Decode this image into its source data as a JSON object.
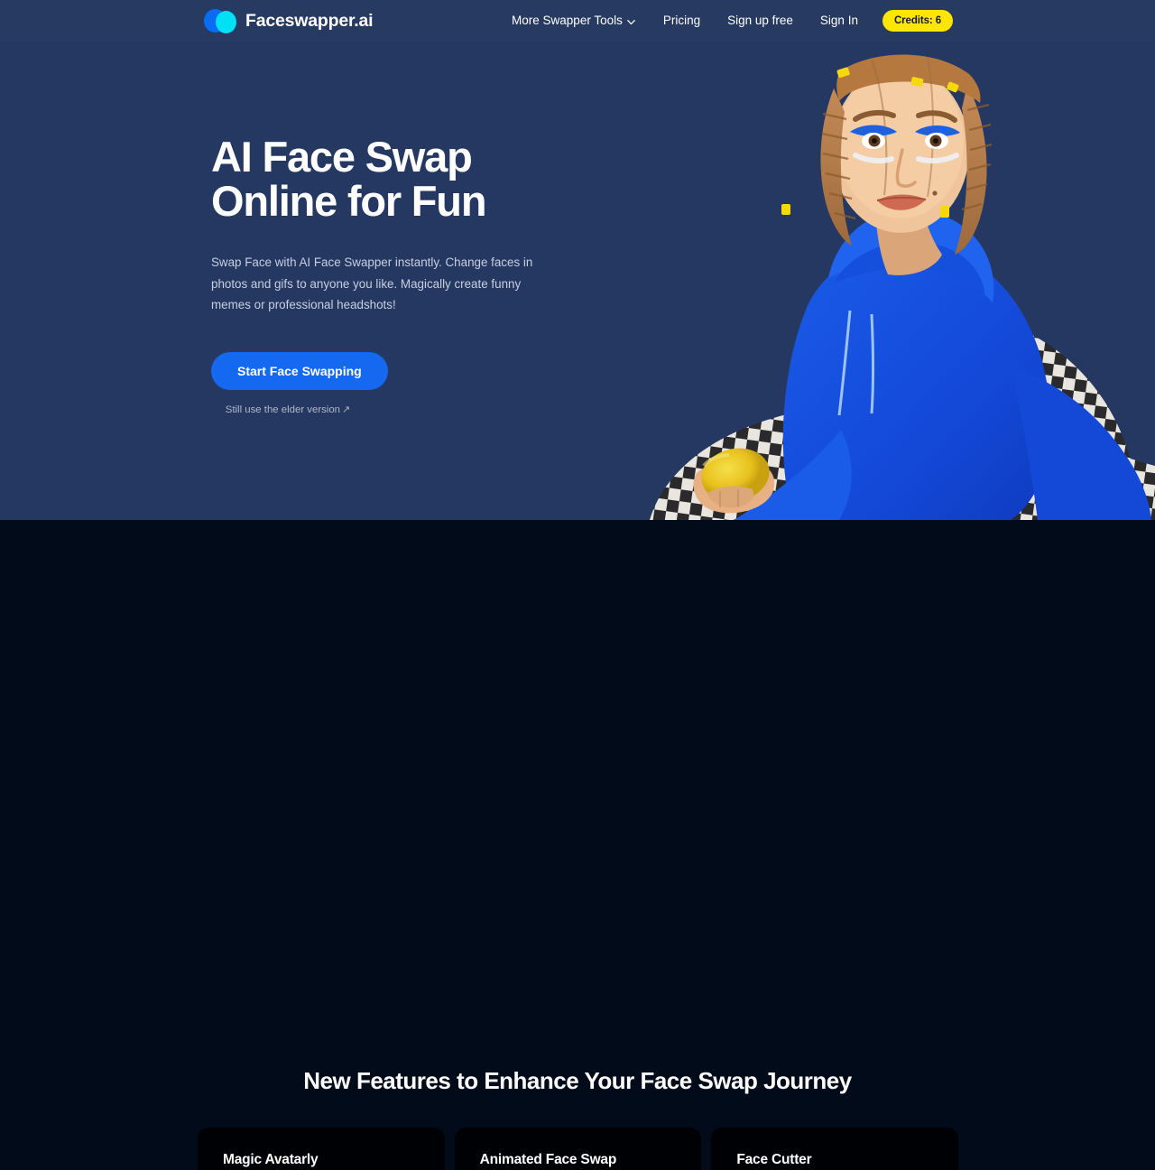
{
  "colors": {
    "header_bg": "#263a62",
    "hero_bg": "#253862",
    "features_bg": "#020b1a",
    "card_bg": "#000105",
    "accent_blue": "#1569f0",
    "badge_yellow": "#ffe600",
    "logo_blue": "#0a6cf2",
    "logo_cyan": "#00e0f5"
  },
  "header": {
    "brand_name": "Faceswapper.ai",
    "logo_icon": "two-overlapping-circles-icon",
    "nav": [
      {
        "label": "More Swapper Tools",
        "icon": "chevron-down-icon",
        "has_dropdown": true
      },
      {
        "label": "Pricing",
        "has_dropdown": false
      },
      {
        "label": "Sign up free",
        "has_dropdown": false
      },
      {
        "label": "Sign In",
        "has_dropdown": false
      }
    ],
    "credits_badge": "Credits: 6"
  },
  "hero": {
    "title": "AI Face Swap\nOnline for Fun",
    "subtitle": "Swap Face with AI Face Swapper instantly. Change faces in photos and gifs to anyone you like. Magically create funny memes or professional headshots!",
    "cta_label": "Start Face Swapping",
    "elder_link_label": "Still use the elder version",
    "elder_link_icon": "external-link-arrow-icon",
    "photo_alt": "Woman with braided hair wearing a blue hoodie and checkered pants holding a lemon"
  },
  "features": {
    "heading": "New Features to Enhance Your Face Swap Journey",
    "cards": [
      {
        "title": "Magic Avatarly"
      },
      {
        "title": "Animated Face Swap"
      },
      {
        "title": "Face Cutter"
      }
    ]
  }
}
